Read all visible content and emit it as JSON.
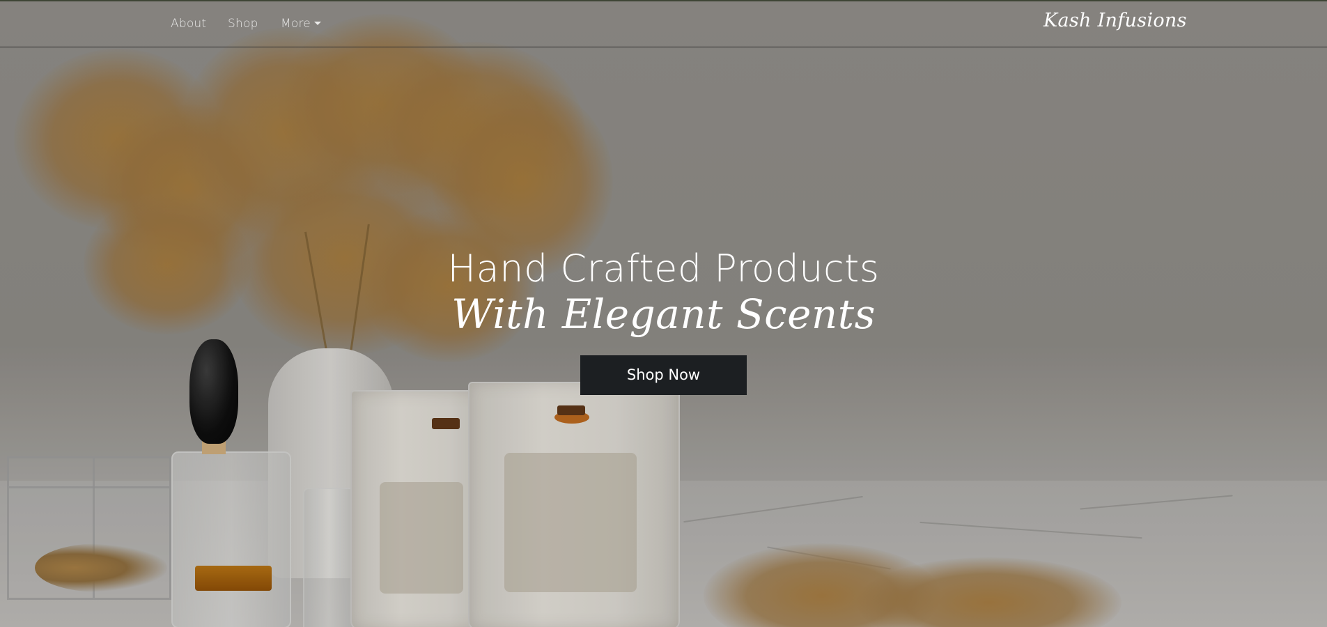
{
  "navbar": {
    "links": [
      {
        "label": "About"
      },
      {
        "label": "Shop"
      },
      {
        "label": "More"
      }
    ],
    "brand": "Kash Infusions"
  },
  "hero": {
    "headline": "Hand Crafted Products",
    "subheadline": "With Elegant Scents",
    "cta_label": "Shop Now",
    "background_image": "candles-perfume-pampas-grass-photo"
  },
  "colors": {
    "cta_background": "#1c1f22",
    "text": "#ffffff",
    "navbar_border": "#3e4535"
  },
  "icons": {
    "more_dropdown": "caret-down-icon"
  }
}
